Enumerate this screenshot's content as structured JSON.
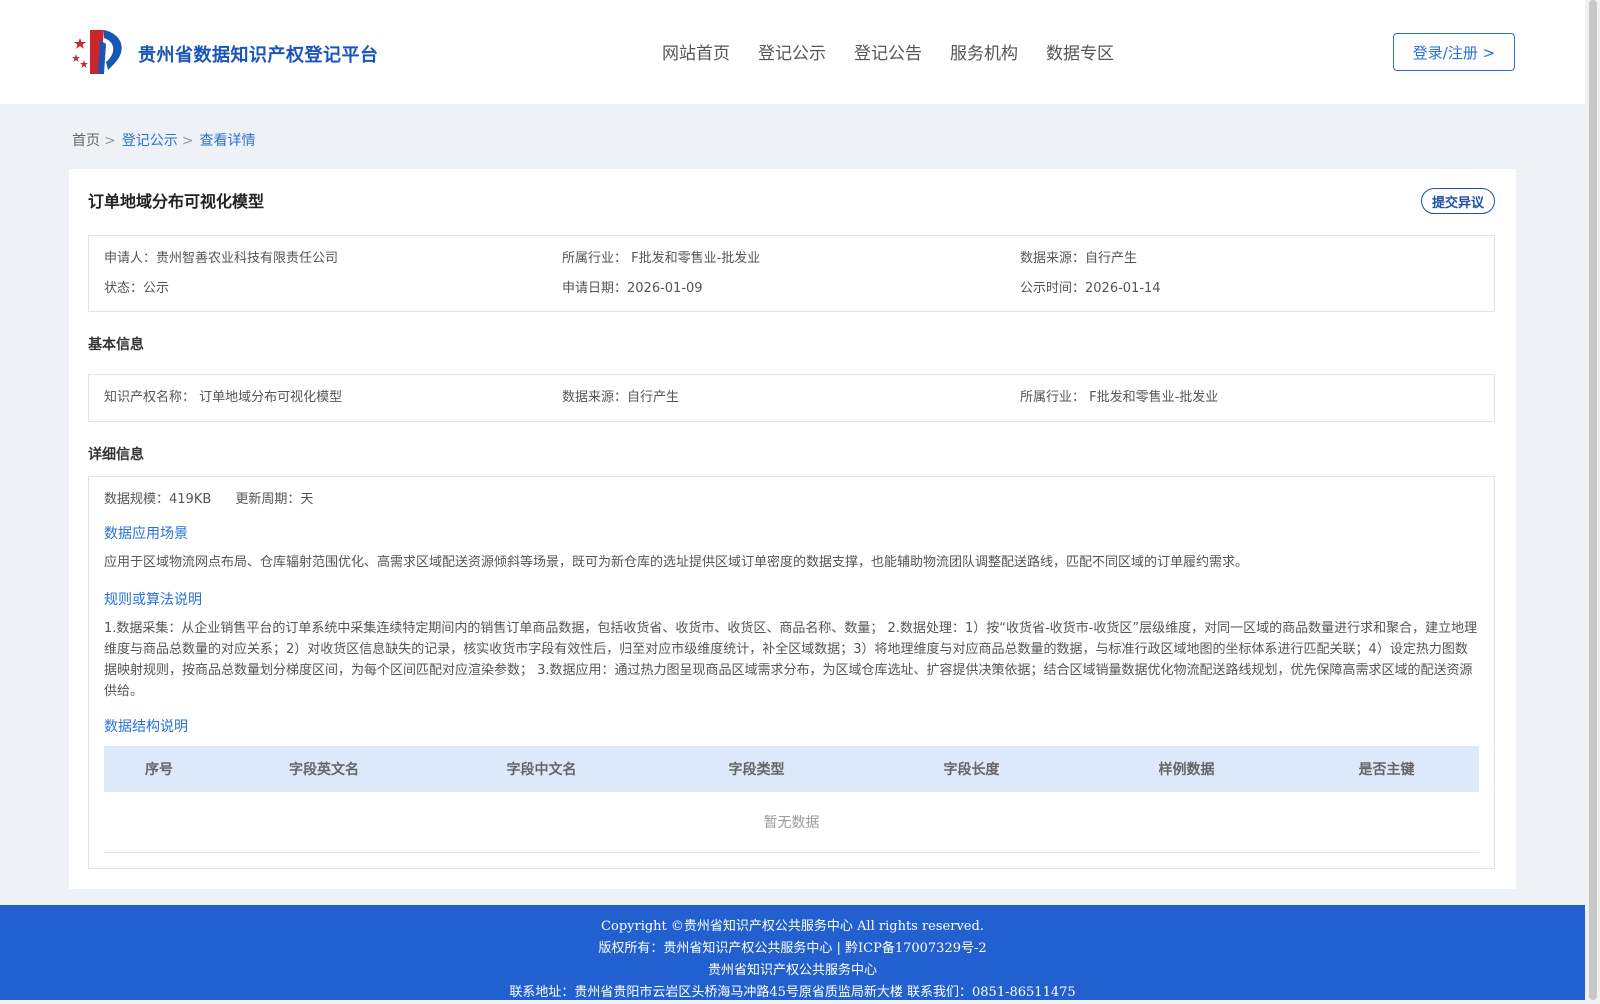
{
  "header": {
    "site_title": "贵州省数据知识产权登记平台",
    "nav": [
      "网站首页",
      "登记公示",
      "登记公告",
      "服务机构",
      "数据专区"
    ],
    "login_label": "登录/注册 >"
  },
  "breadcrumb": {
    "home": "首页",
    "section": "登记公示",
    "current": "查看详情",
    "separator": ">"
  },
  "detail": {
    "title": "订单地域分布可视化模型",
    "objection_label": "提交异议",
    "summary": {
      "applicant": "申请人：贵州智善农业科技有限责任公司",
      "industry": "所属行业： F批发和零售业-批发业",
      "source": "数据来源：自行产生",
      "status": "状态：公示",
      "apply_date": "申请日期：2026-01-09",
      "publish_date": "公示时间：2026-01-14"
    },
    "basic": {
      "title": "基本信息",
      "name": "知识产权名称： 订单地域分布可视化模型",
      "source": "数据来源：自行产生",
      "industry": "所属行业： F批发和零售业-批发业"
    },
    "info": {
      "title": "详细信息",
      "scale": "数据规模：419KB",
      "cycle": "更新周期：天",
      "scenario_title": "数据应用场景",
      "scenario_text": "应用于区域物流网点布局、仓库辐射范围优化、高需求区域配送资源倾斜等场景，既可为新仓库的选址提供区域订单密度的数据支撑，也能辅助物流团队调整配送路线，匹配不同区域的订单履约需求。",
      "rules_title": "规则或算法说明",
      "rules_text": "1.数据采集：从企业销售平台的订单系统中采集连续特定期间内的销售订单商品数据，包括收货省、收货市、收货区、商品名称、数量； 2.数据处理：1）按“收货省-收货市-收货区”层级维度，对同一区域的商品数量进行求和聚合，建立地理维度与商品总数量的对应关系；2）对收货区信息缺失的记录，核实收货市字段有效性后，归至对应市级维度统计，补全区域数据；3）将地理维度与对应商品总数量的数据，与标准行政区域地图的坐标体系进行匹配关联；4）设定热力图数据映射规则，按商品总数量划分梯度区间，为每个区间匹配对应渲染参数； 3.数据应用：通过热力图呈现商品区域需求分布，为区域仓库选址、扩容提供决策依据；结合区域销量数据优化物流配送路线规划，优先保障高需求区域的配送资源供给。",
      "structure_title": "数据结构说明",
      "columns": [
        "序号",
        "字段英文名",
        "字段中文名",
        "字段类型",
        "字段长度",
        "样例数据",
        "是否主键"
      ],
      "empty_text": "暂无数据"
    }
  },
  "footer": {
    "copyright": "Copyright ©贵州省知识产权公共服务中心 All rights reserved.",
    "owner": "版权所有：贵州省知识产权公共服务中心 | 黔ICP备17007329号-2",
    "org": "贵州省知识产权公共服务中心",
    "contact": "联系地址：贵州省贵阳市云岩区头桥海马冲路45号原省质监局新大楼 联系我们：0851-86511475"
  },
  "colors": {
    "brand": "#1a56b8",
    "link": "#2a6fdb",
    "footer_bg": "#2260cf",
    "table_head_bg": "#dbe9fb"
  }
}
